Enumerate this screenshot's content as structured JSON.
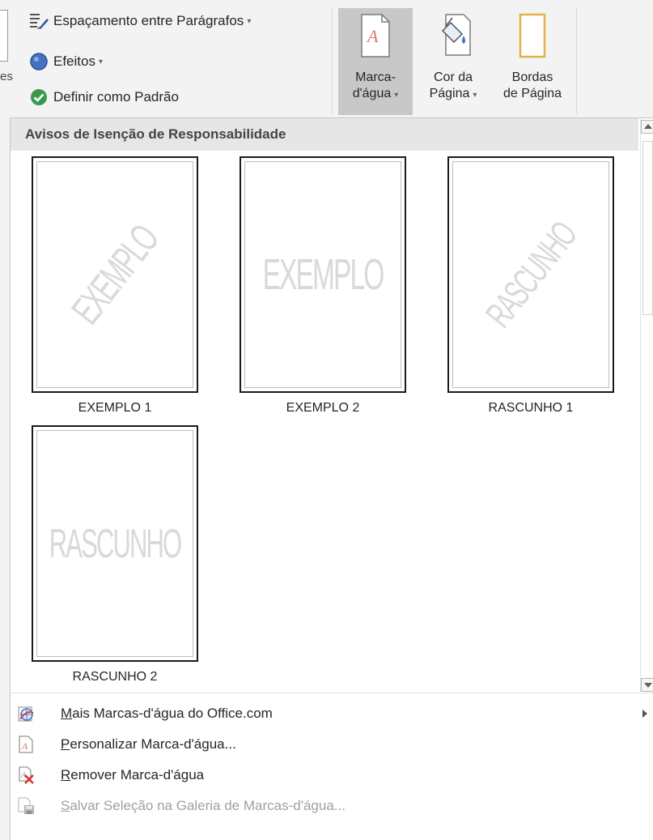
{
  "ribbon": {
    "partial_left_text": "es",
    "paragraph_spacing_label": "Espaçamento entre Parágrafos",
    "effects_label": "Efeitos",
    "set_default_label": "Definir como Padrão",
    "watermark": {
      "line1": "Marca-",
      "line2": "d'água"
    },
    "page_color": {
      "line1": "Cor da",
      "line2": "Página"
    },
    "page_borders": {
      "line1": "Bordas",
      "line2": "de Página"
    },
    "caret": "▾"
  },
  "dropdown": {
    "section_header": "Avisos de Isenção de Responsabilidade",
    "tiles": [
      {
        "watermark_text": "EXEMPLO",
        "style": "diagonal",
        "caption": "EXEMPLO 1"
      },
      {
        "watermark_text": "EXEMPLO",
        "style": "horizontal",
        "caption": "EXEMPLO 2"
      },
      {
        "watermark_text": "RASCUNHO",
        "style": "diagonal",
        "caption": "RASCUNHO 1"
      },
      {
        "watermark_text": "RASCUNHO",
        "style": "horizontal",
        "caption": "RASCUNHO 2"
      }
    ],
    "menu": [
      {
        "underline": "M",
        "rest": "ais Marcas-d'água do Office.com",
        "icon": "office-globe-icon",
        "submenu": true,
        "disabled": false
      },
      {
        "underline": "P",
        "rest": "ersonalizar Marca-d'água...",
        "icon": "custom-watermark-icon",
        "submenu": false,
        "disabled": false
      },
      {
        "underline": "R",
        "rest": "emover Marca-d'água",
        "icon": "remove-watermark-icon",
        "submenu": false,
        "disabled": false
      },
      {
        "underline": "S",
        "rest": "alvar Seleção na Galeria de Marcas-d'água...",
        "icon": "save-to-gallery-icon",
        "submenu": false,
        "disabled": true
      }
    ]
  },
  "colors": {
    "ribbon_bg": "#f3f3f3",
    "active_button": "#c8c8c8",
    "section_header_bg": "#e6e6e6",
    "watermark_text": "#d9d9d9",
    "effects_blue": "#4472c4",
    "check_green": "#3a9a4c",
    "disabled_text": "#a0a0a0"
  }
}
